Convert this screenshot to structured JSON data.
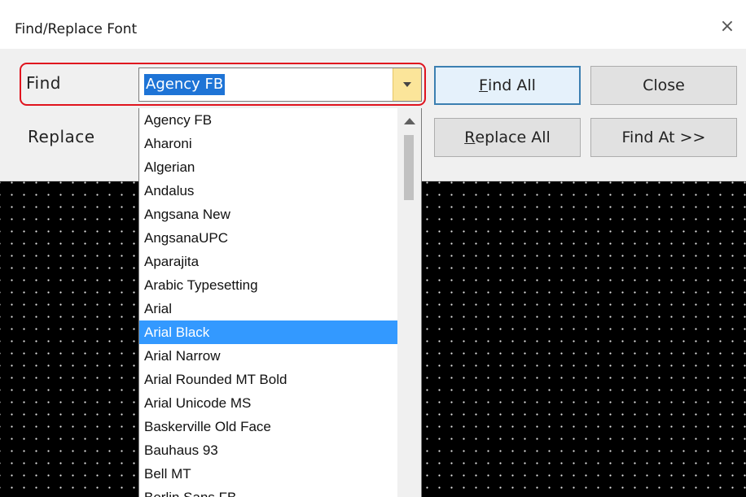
{
  "window": {
    "title": "Find/Replace Font",
    "close_symbol": "×"
  },
  "form": {
    "find_label": "Find",
    "replace_label": "Replace",
    "find_value": "Agency FB"
  },
  "buttons": {
    "find_all": {
      "underlined": "F",
      "rest": "ind All"
    },
    "close": "Close",
    "replace_all": {
      "underlined": "R",
      "rest": "eplace All"
    },
    "find_at": "Find At >>"
  },
  "dropdown": {
    "items": [
      "Agency FB",
      "Aharoni",
      "Algerian",
      "Andalus",
      "Angsana New",
      "AngsanaUPC",
      "Aparajita",
      "Arabic Typesetting",
      "Arial",
      "Arial Black",
      "Arial Narrow",
      "Arial Rounded MT Bold",
      "Arial Unicode MS",
      "Baskerville Old Face",
      "Bauhaus 93",
      "Bell MT",
      "Berlin Sans FB"
    ],
    "selected_index": 9
  },
  "colors": {
    "highlight_border": "#e0141e",
    "selection": "#3399ff",
    "dropdown_arrow_bg": "#fbe59a"
  },
  "icons": {
    "close": "close-icon",
    "dropdown_arrow": "chevron-down-icon",
    "scroll_up": "scroll-up-arrow-icon"
  }
}
